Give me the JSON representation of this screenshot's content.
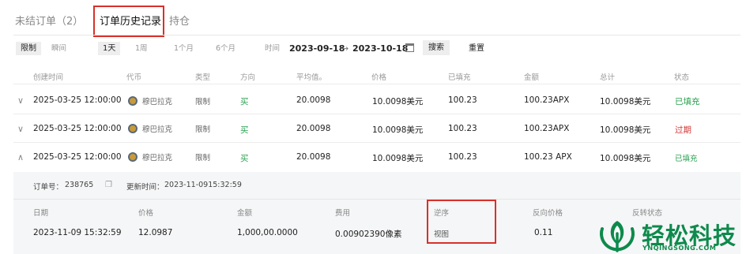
{
  "tabs": [
    "未结订单（2）",
    "订单历史记录",
    "持仓"
  ],
  "filters": {
    "type_labels": [
      "限制",
      "瞬间"
    ],
    "range_labels": [
      "1天",
      "1周",
      "1个月",
      "6个月"
    ],
    "time_label": "时间",
    "date_from": "2023-09-18",
    "arrow": "→",
    "date_to": "2023-10-18",
    "search": "搜索",
    "reset": "重置"
  },
  "columns": [
    "创建时间",
    "代币",
    "类型",
    "方向",
    "平均值。",
    "价格",
    "已填充",
    "金额",
    "总计",
    "状态"
  ],
  "rows": [
    {
      "chevron": "∨",
      "time": "2025-03-25 12:00:00",
      "token": "穆巴拉克",
      "type": "限制",
      "side": "买",
      "avg": "20.0098",
      "price": "10.0098美元",
      "filled": "100.23",
      "amount": "100.23APX",
      "total": "10.0098美元",
      "status": "已填充"
    },
    {
      "chevron": "∨",
      "time": "2025-03-25 12:00:00",
      "token": "穆巴拉克",
      "type": "限制",
      "side": "买",
      "avg": "20.0098",
      "price": "10.0098美元",
      "filled": "100.23",
      "amount": "100.23APX",
      "total": "10.0098美元",
      "status": "过期"
    },
    {
      "chevron": "∧",
      "time": "2025-03-25 12:00:00",
      "token": "穆巴拉克",
      "type": "限制",
      "side": "买",
      "avg": "20.0098",
      "price": "10.0098美元",
      "filled": "100.23",
      "amount": "100.23 APX",
      "total": "10.0098美元",
      "status": "已填充"
    }
  ],
  "detail": {
    "order_label": "订单号：",
    "order_no": "238765",
    "updated_label": "更新时间：",
    "updated_value": "2023-11-0915:32:59",
    "columns": [
      "日期",
      "价格",
      "金额",
      "费用",
      "逆序",
      "反向价格",
      "反转状态"
    ],
    "row": {
      "date": "2023-11-09 15:32:59",
      "price": "12.0987",
      "amount": "1,000,00.0000",
      "fee": "0.00902390像素",
      "reverse": "视图",
      "reverse_price": "0.11",
      "reverse_status": ""
    }
  },
  "watermark": {
    "title": "轻松科技",
    "subtitle": "YNQINGSONG.COM"
  },
  "colors": {
    "accent_green": "#2aa050",
    "status_red": "#d43a3a",
    "highlight_box": "#d9302a",
    "brand_green": "#0d8a4c"
  }
}
